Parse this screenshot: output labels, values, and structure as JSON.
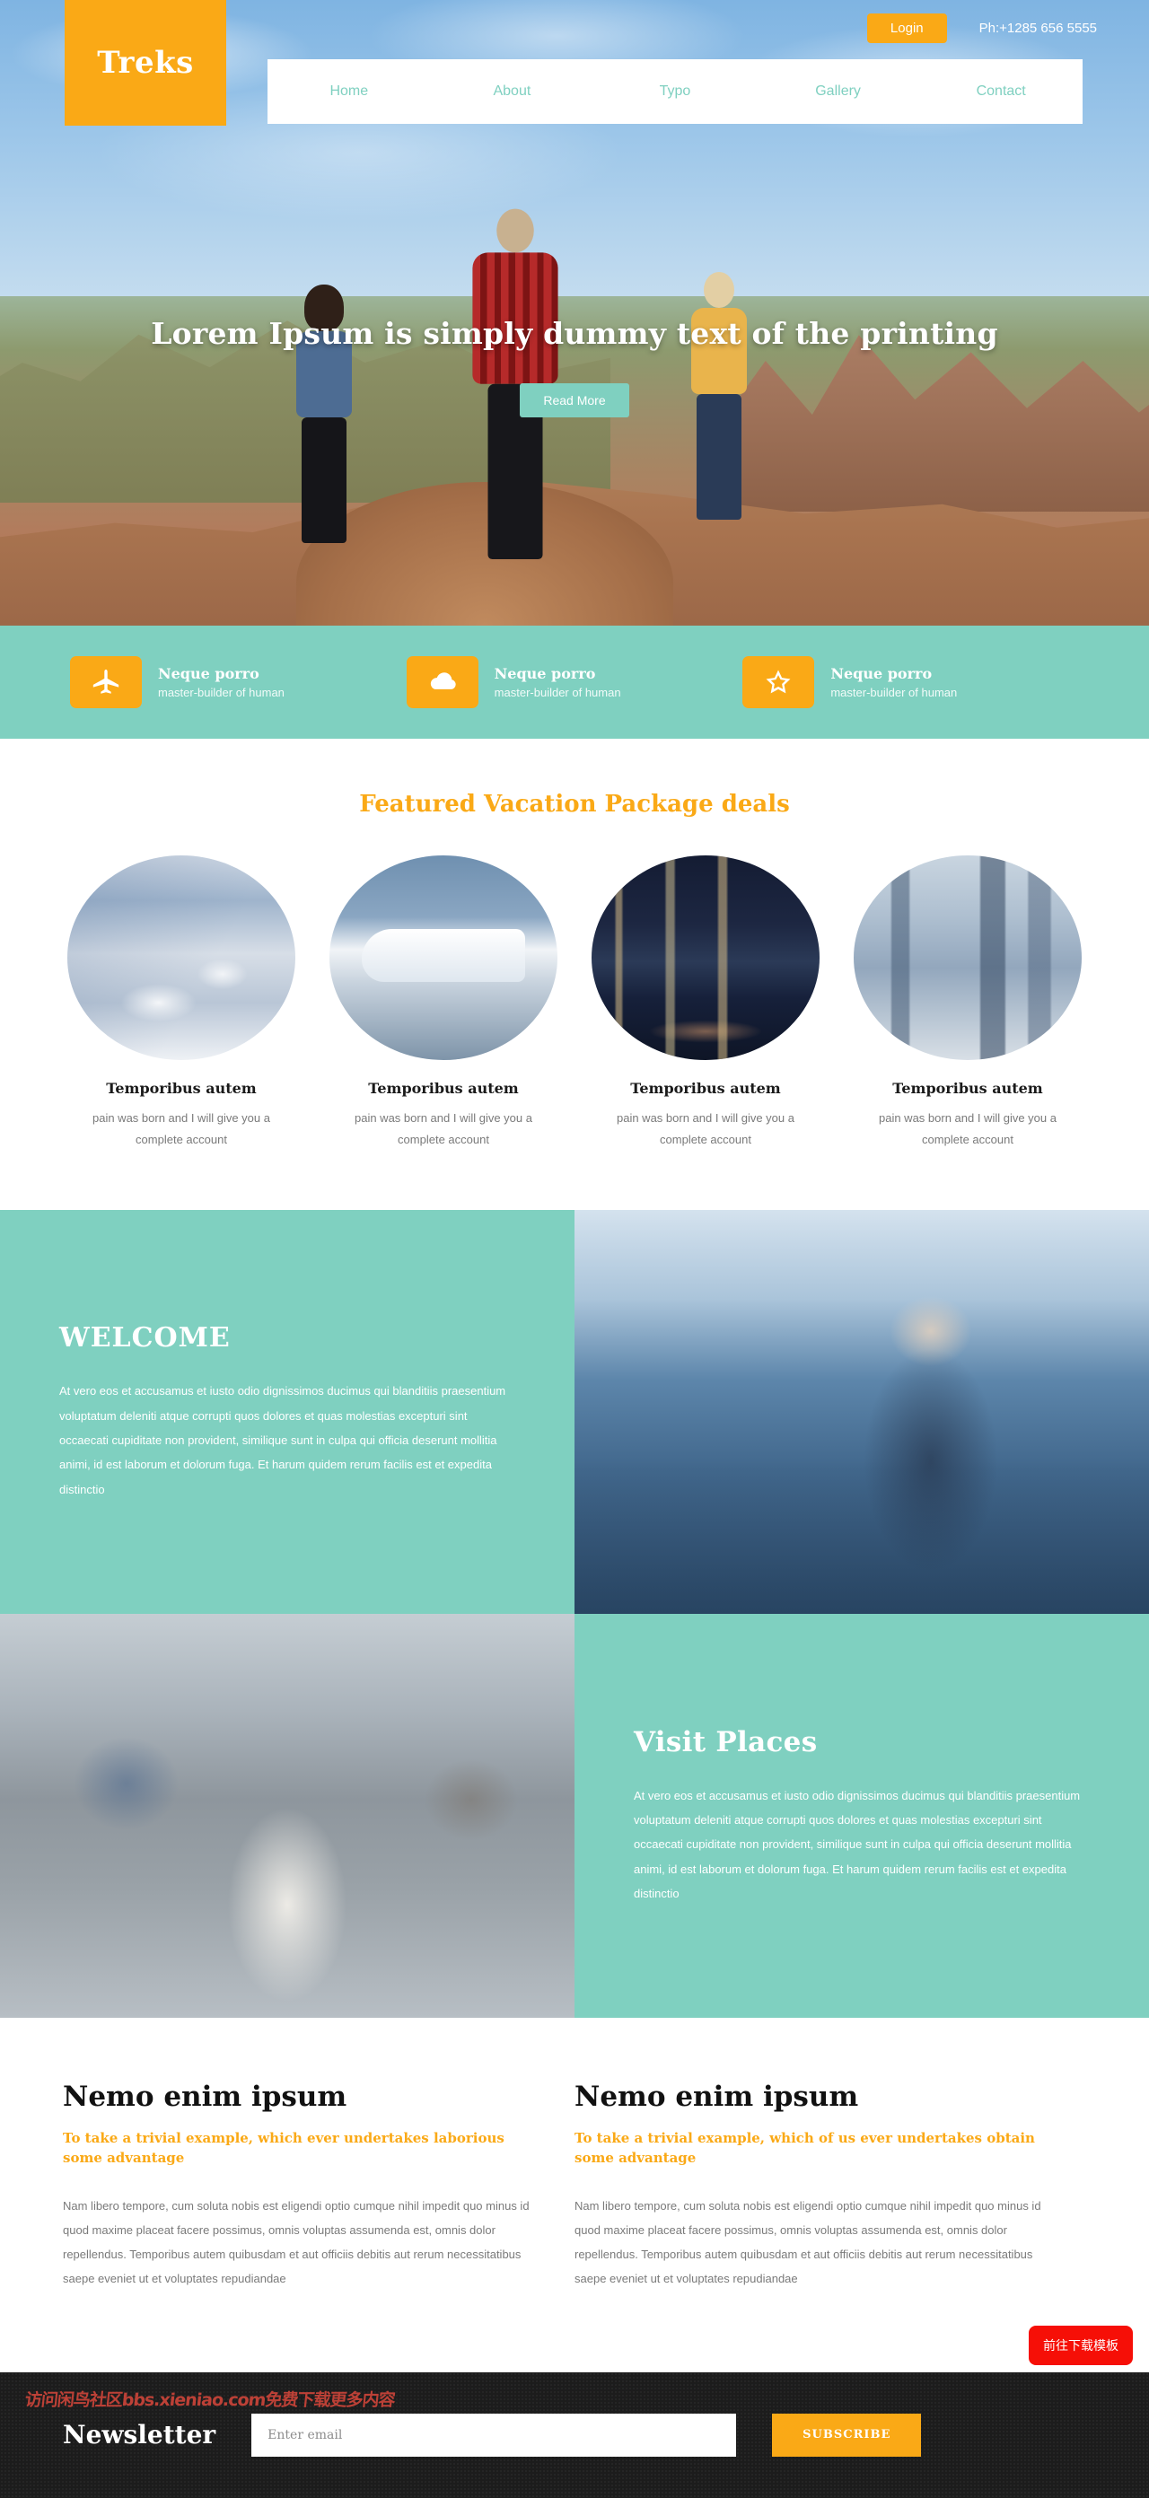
{
  "brand": {
    "name": "Treks"
  },
  "topbar": {
    "login_label": "Login",
    "phone": "Ph:+1285 656 5555"
  },
  "nav": {
    "items": [
      {
        "label": "Home",
        "active": true
      },
      {
        "label": "About",
        "active": false
      },
      {
        "label": "Typo",
        "active": false
      },
      {
        "label": "Gallery",
        "active": false
      },
      {
        "label": "Contact",
        "active": false
      }
    ]
  },
  "hero": {
    "title": "Lorem Ipsum is simply dummy text of the printing",
    "cta_label": "Read More"
  },
  "features": [
    {
      "icon": "plane-icon",
      "title": "Neque porro",
      "subtitle": "master-builder of human"
    },
    {
      "icon": "cloud-icon",
      "title": "Neque porro",
      "subtitle": "master-builder of human"
    },
    {
      "icon": "star-icon",
      "title": "Neque porro",
      "subtitle": "master-builder of human"
    }
  ],
  "packages": {
    "heading": "Featured Vacation Package deals",
    "items": [
      {
        "image": "santorini-coastal-village",
        "title": "Temporibus autem",
        "desc": "pain was born and I will give you a complete account"
      },
      {
        "image": "cruise-ship-at-port",
        "title": "Temporibus autem",
        "desc": "pain was born and I will give you a complete account"
      },
      {
        "image": "city-skyline-at-night",
        "title": "Temporibus autem",
        "desc": "pain was born and I will give you a complete account"
      },
      {
        "image": "singapore-merlion-skyline",
        "title": "Temporibus autem",
        "desc": "pain was born and I will give you a complete account"
      }
    ]
  },
  "welcome": {
    "heading": "WELCOME",
    "body": "At vero eos et accusamus et iusto odio dignissimos ducimus qui blanditiis praesentium voluptatum deleniti atque corrupti quos dolores et quas molestias excepturi sint occaecati cupiditate non provident, similique sunt in culpa qui officia deserunt mollitia animi, id est laborum et dolorum fuga. Et harum quidem rerum facilis est et expedita distinctio",
    "image": "woman-with-headscarf-by-the-sea"
  },
  "visit": {
    "heading": "Visit Places",
    "body": "At vero eos et accusamus et iusto odio dignissimos ducimus qui blanditiis praesentium voluptatum deleniti atque corrupti quos dolores et quas molestias excepturi sint occaecati cupiditate non provident, similique sunt in culpa qui officia deserunt mollitia animi, id est laborum et dolorum fuga. Et harum quidem rerum facilis est et expedita distinctio",
    "image": "backpacker-on-busy-street"
  },
  "nemo": [
    {
      "title": "Nemo enim ipsum",
      "subtitle": "To take a trivial example, which ever undertakes laborious some advantage",
      "body": "Nam libero tempore, cum soluta nobis est eligendi optio cumque nihil impedit quo minus id quod maxime placeat facere possimus, omnis voluptas assumenda est, omnis dolor repellendus. Temporibus autem quibusdam et aut officiis debitis aut rerum necessitatibus saepe eveniet ut et voluptates repudiandae"
    },
    {
      "title": "Nemo enim ipsum",
      "subtitle": "To take a trivial example, which of us ever undertakes obtain some advantage",
      "body": "Nam libero tempore, cum soluta nobis est eligendi optio cumque nihil impedit quo minus id quod maxime placeat facere possimus, omnis voluptas assumenda est, omnis dolor repellendus. Temporibus autem quibusdam et aut officiis debitis aut rerum necessitatibus saepe eveniet ut et voluptates repudiandae"
    }
  ],
  "footer": {
    "newsletter_title": "Newsletter",
    "email_placeholder": "Enter email",
    "subscribe_label": "SUBSCRIBE",
    "watermark": "访问闲鸟社区bbs.xieniao.com免费下载更多内容",
    "download_button": "前往下载模板"
  },
  "colors": {
    "accent_orange": "#faa916",
    "accent_teal": "#7fd0c0",
    "footer_dark": "#1c1c1c",
    "download_red": "#f60f07"
  }
}
